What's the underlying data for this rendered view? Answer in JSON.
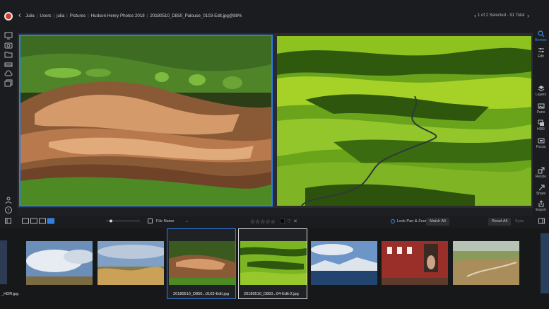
{
  "window": {
    "breadcrumbs": [
      "Julia",
      "Users",
      "julia",
      "Pictures",
      "Hudson Henry Photos 2018",
      "20180510_D850_Palouse_0103-Edit.jpg@88%"
    ],
    "selection_info": "1 of 2 Selected - 91 Total"
  },
  "colors": {
    "accent": "#2f7fe2",
    "background": "#1e1f22",
    "panel": "#1b1c1f"
  },
  "right_panel": {
    "tools": [
      {
        "label": "Browse",
        "icon": "browse-icon",
        "active": true
      },
      {
        "label": "Edit",
        "icon": "sliders-icon",
        "active": false
      },
      {
        "label": "Layers",
        "icon": "layers-icon",
        "active": false
      },
      {
        "label": "Pano",
        "icon": "pano-icon",
        "active": false
      },
      {
        "label": "HDR",
        "icon": "hdr-icon",
        "active": false
      },
      {
        "label": "Focus",
        "icon": "focus-icon",
        "active": false
      },
      {
        "label": "Resize",
        "icon": "resize-icon",
        "active": false
      },
      {
        "label": "Share",
        "icon": "share-icon",
        "active": false
      },
      {
        "label": "Export",
        "icon": "export-icon",
        "active": false
      }
    ]
  },
  "left_sidebar": {
    "icons": [
      "monitor-icon",
      "camera-icon",
      "folder-icon",
      "drive-icon",
      "cloud-icon",
      "albums-icon",
      "person-icon",
      "help-icon"
    ]
  },
  "toolbar": {
    "sort_label": "File Name",
    "lock_label": "Lock Pan & Zoom",
    "match_label": "Match All",
    "reset_label": "Reset All",
    "sync_label": "Sync",
    "rating_stars": "☆☆☆☆☆"
  },
  "filmstrip": {
    "captions": {
      "first": "_HDR.jpg",
      "selected_primary": "20180510_D850...0103-Edit.jpg",
      "selected_secondary": "20180510_D850...04-Edit-2.jpg"
    }
  }
}
